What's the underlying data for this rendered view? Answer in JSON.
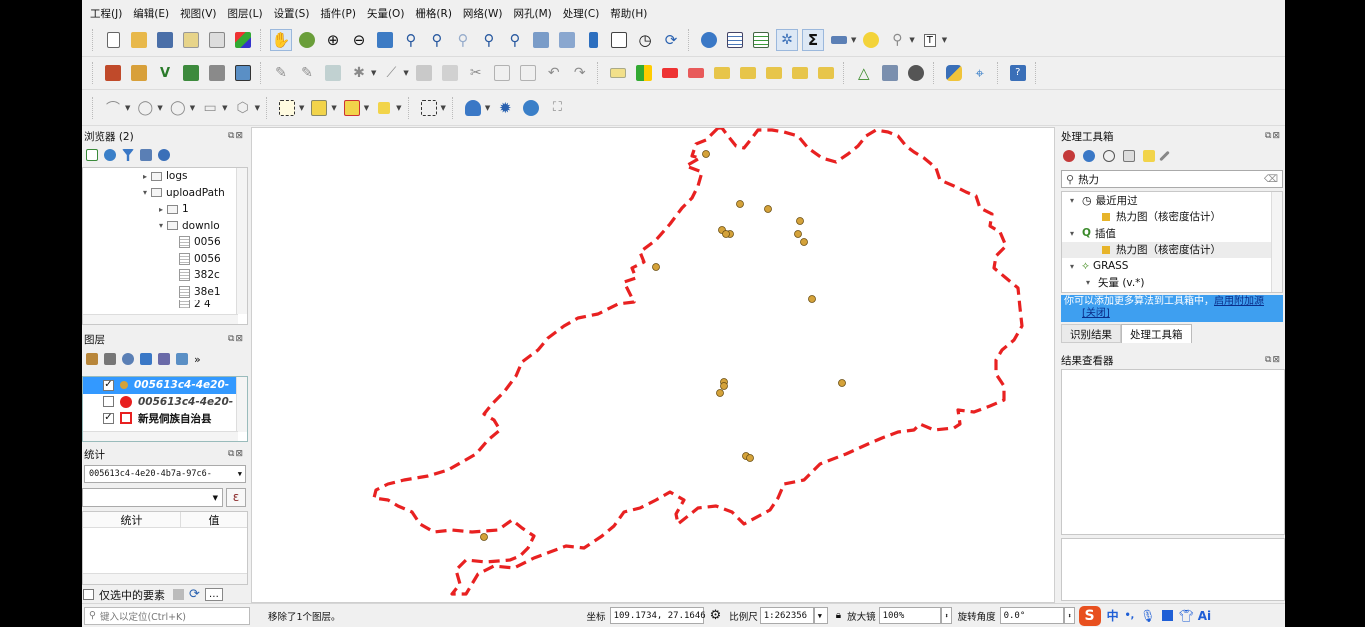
{
  "menu": [
    "工程(J)",
    "编辑(E)",
    "视图(V)",
    "图层(L)",
    "设置(S)",
    "插件(P)",
    "矢量(O)",
    "栅格(R)",
    "网络(W)",
    "网孔(M)",
    "处理(C)",
    "帮助(H)"
  ],
  "browser": {
    "title": "浏览器 (2)",
    "items": [
      "logs",
      "uploadPath",
      "1",
      "downlo",
      "0056",
      "0056",
      "382c",
      "38e1",
      "2 4"
    ]
  },
  "layers": {
    "title": "图层",
    "items": [
      "005613c4-4e20-",
      "005613c4-4e20-",
      "新晃侗族自治县"
    ]
  },
  "stats": {
    "title": "统计",
    "layer_select": "005613c4-4e20-4b7a-97c6-",
    "col_stat": "统计",
    "col_value": "值",
    "selected_only": "仅选中的要素",
    "epsilon": "ε"
  },
  "toolbox": {
    "title": "处理工具箱",
    "search_value": "热力",
    "tree": [
      "最近用过",
      "热力图（核密度估计）",
      "插值",
      "热力图（核密度估计）",
      "GRASS",
      "矢量 (v.*)"
    ],
    "notice_text": "你可以添加更多算法到工具箱中，",
    "notice_link": "启用附加源",
    "notice_close": "[关闭]",
    "tab_identify": "识别结果",
    "tab_toolbox": "处理工具箱",
    "results_title": "结果查看器"
  },
  "status": {
    "locate_placeholder": "键入以定位(Ctrl+K)",
    "message": "移除了1个图层。",
    "coord_label": "坐标",
    "coord_value": "109.1734, 27.1646",
    "scale_label": "比例尺",
    "scale_value": "1:262356",
    "magnifier_label": "放大镜",
    "magnifier_value": "100%",
    "rotation_label": "旋转角度",
    "rotation_value": "0.0°",
    "ime_label": "中",
    "ai_label": "Ai"
  },
  "colors": {
    "boundary": "#e82121",
    "point_fill": "#d4a23a",
    "point_stroke": "#6b4f12",
    "selection": "#3399ff",
    "notice_bg": "#3e9ff0"
  }
}
